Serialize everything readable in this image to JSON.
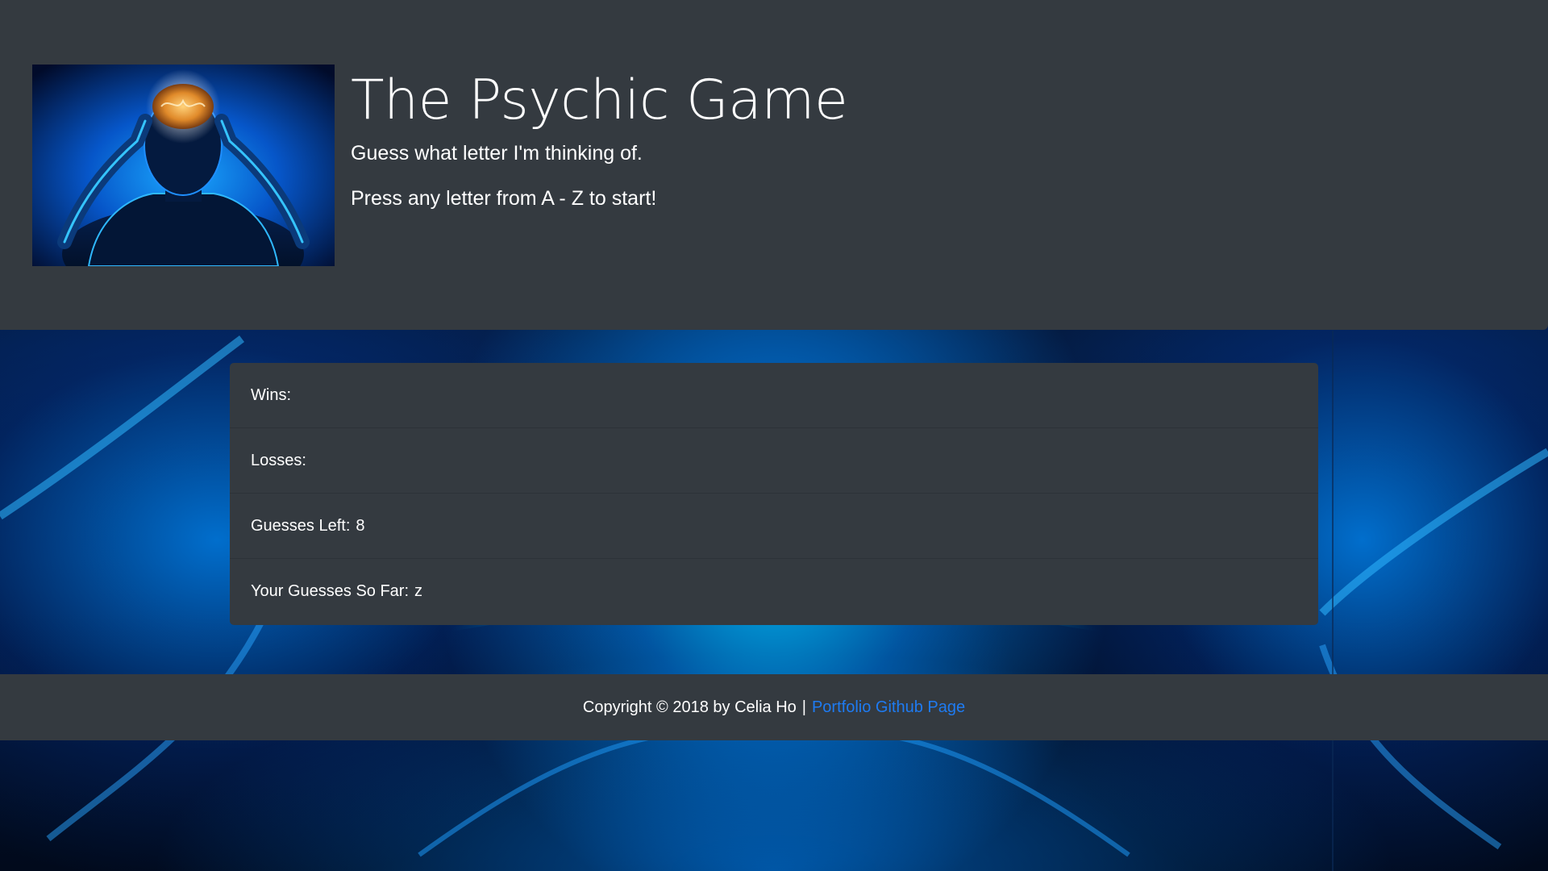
{
  "header": {
    "title": "The Psychic Game",
    "subtitle": "Guess what letter I'm thinking of.",
    "instruction": "Press any letter from A - Z to start!"
  },
  "stats": {
    "wins_label": "Wins:",
    "wins_value": "",
    "losses_label": "Losses:",
    "losses_value": "",
    "guesses_left_label": "Guesses Left:",
    "guesses_left_value": "8",
    "guesses_so_far_label": "Your Guesses So Far:",
    "guesses_so_far_value": "z"
  },
  "footer": {
    "copyright": "Copyright © 2018 by Celia Ho",
    "separator": "|",
    "link_text": "Portfolio Github Page"
  },
  "colors": {
    "panel": "#343a40",
    "link": "#1e7bf2",
    "accent_glow": "#00c8ff"
  },
  "icons": {
    "hero": "psychic-head-glowing-brain-image",
    "background": "glowing-blue-figure-background"
  }
}
